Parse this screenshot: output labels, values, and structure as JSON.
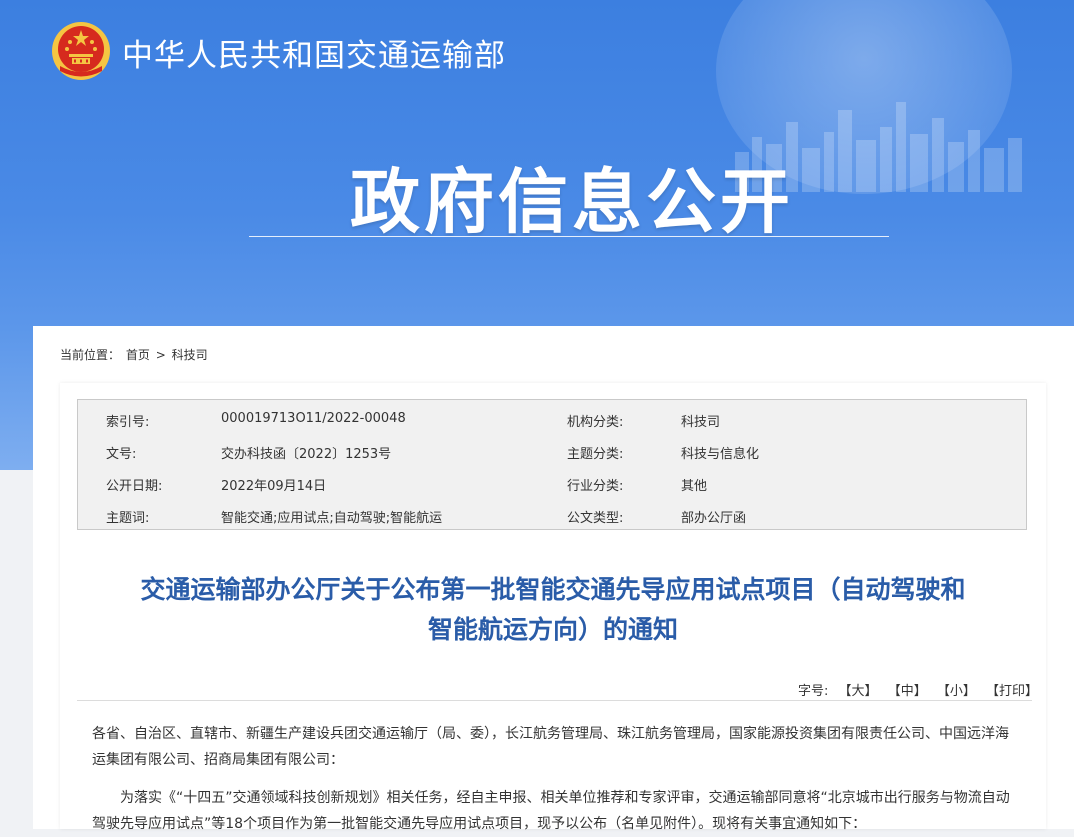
{
  "header": {
    "ministry_name": "中华人民共和国交通运输部",
    "banner_title": "政府信息公开",
    "emblem_icon": "national-emblem-icon"
  },
  "breadcrumb": {
    "prefix": "当前位置：",
    "home": "首页",
    "separator": ">",
    "current": "科技司"
  },
  "meta": {
    "index_label": "索引号:",
    "index_value": "000019713O11/2022-00048",
    "org_label": "机构分类:",
    "org_value": "科技司",
    "docno_label": "文号:",
    "docno_value": "交办科技函〔2022〕1253号",
    "topic_label": "主题分类:",
    "topic_value": "科技与信息化",
    "date_label": "公开日期:",
    "date_value": "2022年09月14日",
    "industry_label": "行业分类:",
    "industry_value": "其他",
    "keywords_label": "主题词:",
    "keywords_value": "智能交通;应用试点;自动驾驶;智能航运",
    "doctype_label": "公文类型:",
    "doctype_value": "部办公厅函"
  },
  "document": {
    "title_line1": "交通运输部办公厅关于公布第一批智能交通先导应用试点项目（自动驾驶和",
    "title_line2": "智能航运方向）的通知",
    "font_size_label": "字号:",
    "large": "【大】",
    "medium": "【中】",
    "small": "【小】",
    "print": "【打印】",
    "paragraph1": "各省、自治区、直辖市、新疆生产建设兵团交通运输厅（局、委），长江航务管理局、珠江航务管理局，国家能源投资集团有限责任公司、中国远洋海运集团有限公司、招商局集团有限公司：",
    "paragraph2": "为落实《“十四五”交通领域科技创新规划》相关任务，经自主申报、相关单位推荐和专家评审，交通运输部同意将“北京城市出行服务与物流自动驾驶先导应用试点”等18个项目作为第一批智能交通先导应用试点项目，现予以公布（名单见附件）。现将有关事宜通知如下："
  },
  "colors": {
    "banner_top": "#3c7fe0",
    "banner_bottom": "#7eaef0",
    "title_blue": "#2a5ca8",
    "emblem_red": "#d62a1e",
    "emblem_gold": "#f5c542"
  }
}
